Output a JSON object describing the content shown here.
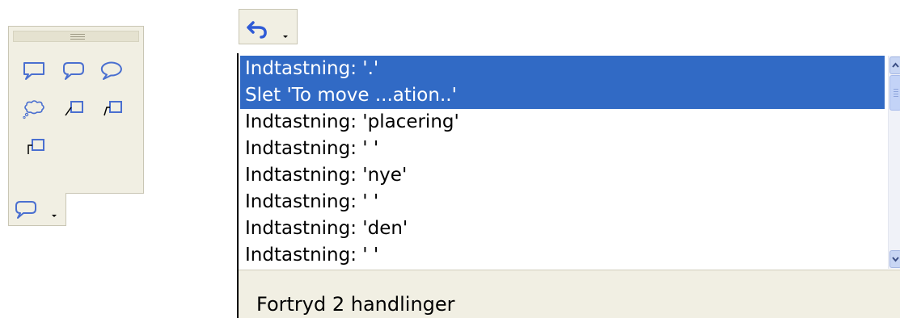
{
  "callout_toolbar": {
    "tools": [
      {
        "icon": "rectangular-callout-icon"
      },
      {
        "icon": "rounded-rectangular-callout-icon"
      },
      {
        "icon": "oval-callout-icon"
      },
      {
        "icon": "cloud-callout-icon"
      },
      {
        "icon": "line-callout-1-icon"
      },
      {
        "icon": "line-callout-2-icon"
      },
      {
        "icon": "line-callout-3-icon"
      }
    ],
    "current_tool_icon": "rounded-rectangular-callout-icon"
  },
  "undo_button": {
    "icon": "undo-icon",
    "dropdown_icon": "chevron-down-icon"
  },
  "undo_list": {
    "items": [
      {
        "label": "Indtastning: '.'",
        "selected": true
      },
      {
        "label": "Slet 'To move ...ation..'",
        "selected": true
      },
      {
        "label": "Indtastning: 'placering'",
        "selected": false
      },
      {
        "label": "Indtastning: ' '",
        "selected": false
      },
      {
        "label": "Indtastning: 'nye'",
        "selected": false
      },
      {
        "label": "Indtastning: ' '",
        "selected": false
      },
      {
        "label": "Indtastning: 'den'",
        "selected": false
      },
      {
        "label": "Indtastning: ' '",
        "selected": false
      }
    ],
    "status": "Fortryd 2 handlinger"
  },
  "colors": {
    "selection": "#316ac5",
    "toolbar_bg": "#f1efe3",
    "icon_stroke": "#4a6fd0",
    "undo_icon": "#2f5bd6"
  }
}
